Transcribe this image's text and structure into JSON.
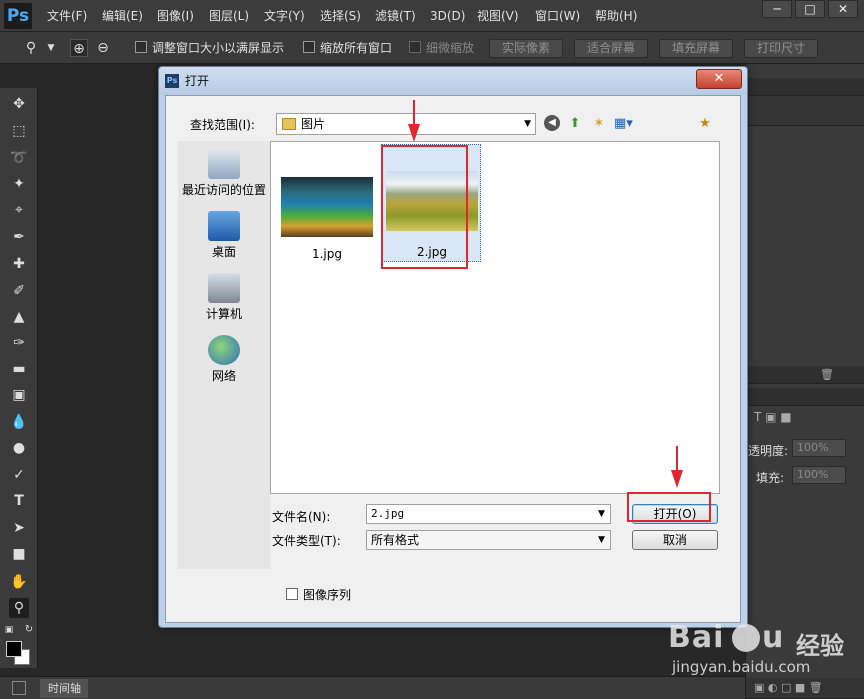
{
  "app": {
    "logo": "Ps"
  },
  "menu": {
    "items": [
      "文件(F)",
      "编辑(E)",
      "图像(I)",
      "图层(L)",
      "文字(Y)",
      "选择(S)",
      "滤镜(T)",
      "3D(D)",
      "视图(V)",
      "窗口(W)",
      "帮助(H)"
    ]
  },
  "window_controls": {
    "minimize": "─",
    "maximize": "□",
    "close": "✕"
  },
  "options_bar": {
    "resize_windows_label": "调整窗口大小以满屏显示",
    "zoom_all_label": "缩放所有窗口",
    "scrubby_zoom_label": "细微缩放",
    "actual_pixels": "实际像素",
    "fit_screen": "适合屏幕",
    "fill_screen": "填充屏幕",
    "print_size": "打印尺寸"
  },
  "right_panel": {
    "opacity_label": "透明度:",
    "opacity_value": "100%",
    "fill_label": "填充:",
    "fill_value": "100%"
  },
  "timeline": {
    "tab_label": "时间轴"
  },
  "dialog": {
    "title": "打开",
    "lookin_label": "查找范围(I):",
    "lookin_value": "图片",
    "places": [
      {
        "label": "最近访问的位置",
        "icon": "recent-places-icon"
      },
      {
        "label": "桌面",
        "icon": "desktop-icon"
      },
      {
        "label": "计算机",
        "icon": "computer-icon"
      },
      {
        "label": "网络",
        "icon": "network-icon"
      }
    ],
    "files": [
      {
        "name": "1.jpg",
        "selected": false
      },
      {
        "name": "2.jpg",
        "selected": true
      }
    ],
    "filename_label": "文件名(N):",
    "filename_value": "2.jpg",
    "filetype_label": "文件类型(T):",
    "filetype_value": "所有格式",
    "open_button": "打开(O)",
    "cancel_button": "取消",
    "image_sequence_label": "图像序列"
  },
  "watermark": {
    "brand": "Bai",
    "brand_cn": "经验",
    "url": "jingyan.baidu.com"
  },
  "colors": {
    "annotation_red": "#e0262e",
    "dialog_frame": "#bcd0e8",
    "app_bg": "#282828"
  }
}
